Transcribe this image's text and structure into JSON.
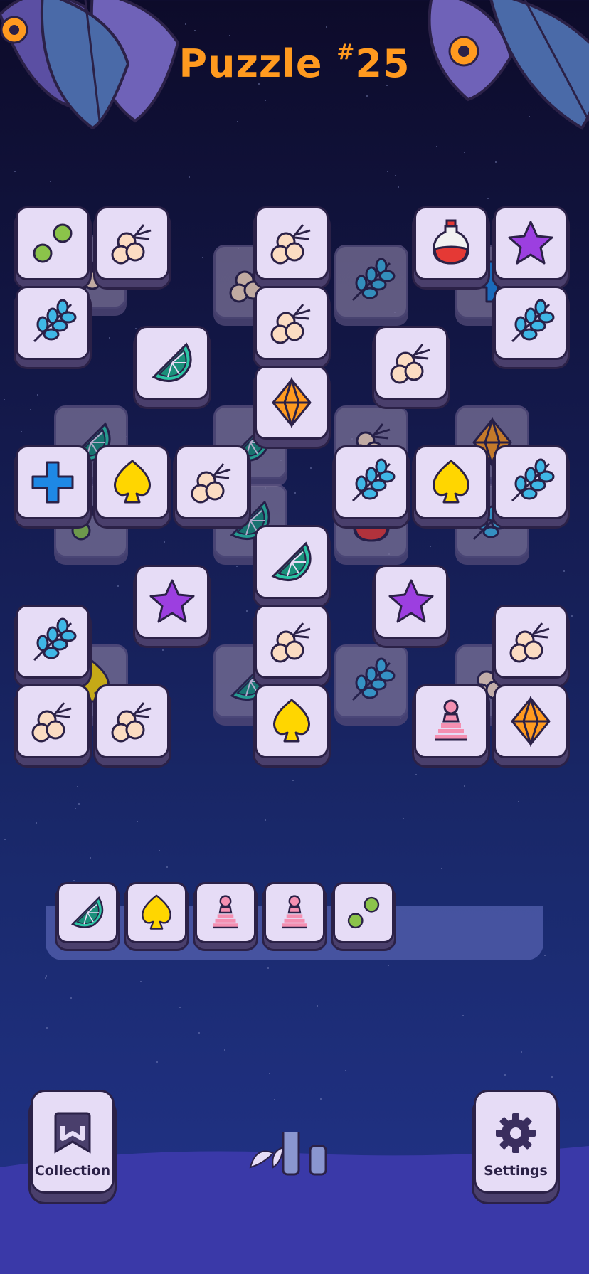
{
  "header": {
    "title_word": "Puzzle",
    "title_hash": "#",
    "title_number": "25"
  },
  "icons": {
    "dots": "two-green-dots-icon",
    "berries": "berries-icon",
    "potion": "potion-bottle-icon",
    "star": "purple-star-icon",
    "leaves": "leafy-branch-icon",
    "lime": "lime-slice-icon",
    "diamond": "orange-diamond-icon",
    "cross": "blue-cross-icon",
    "spade": "yellow-spade-icon",
    "pawn": "pink-pawn-icon"
  },
  "tray": {
    "tiles": [
      "lime",
      "spade",
      "pawn",
      "pawn",
      "dots"
    ]
  },
  "buttons": {
    "collection_label": "Collection",
    "settings_label": "Settings"
  },
  "colors": {
    "title": "#ff9a1f",
    "tile_face": "#e6dcf6",
    "tile_outline": "#2b2147",
    "ground": "#3a39a8"
  }
}
